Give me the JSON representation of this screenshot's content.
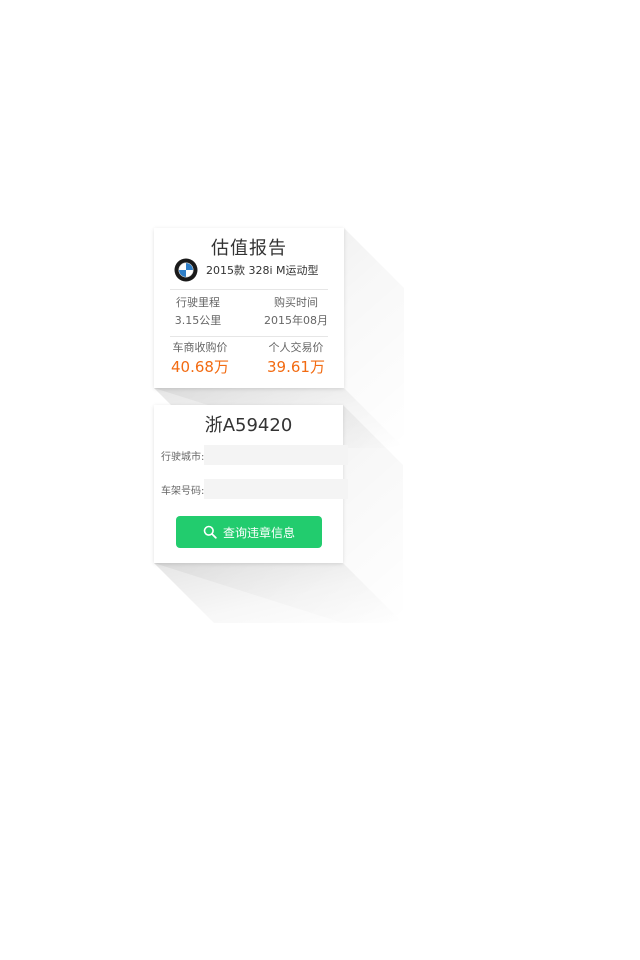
{
  "colors": {
    "accent_orange": "#f26b12",
    "button_green": "#22cc6e",
    "text_dark": "#333333",
    "text_muted": "#666666",
    "input_bg": "#f4f4f4"
  },
  "valuation": {
    "title": "估值报告",
    "brand_icon": "bmw-logo",
    "model": "2015款 328i M运动型",
    "mileage_label": "行驶里程",
    "mileage_value": "3.15公里",
    "purchase_label": "购买时间",
    "purchase_value": "2015年08月",
    "dealer_price_label": "车商收购价",
    "dealer_price_value": "40.68万",
    "private_price_label": "个人交易价",
    "private_price_value": "39.61万"
  },
  "query": {
    "plate": "浙A59420",
    "city_label": "行驶城市:",
    "city_value": "",
    "vin_label": "车架号码:",
    "vin_value": "",
    "button_icon": "search-icon",
    "button_label": "查询违章信息"
  }
}
